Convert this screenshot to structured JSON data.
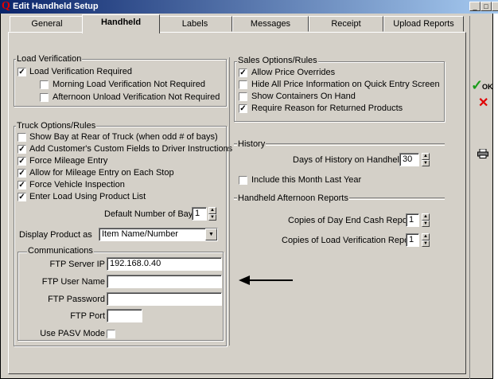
{
  "window": {
    "title": "Edit Handheld Setup"
  },
  "tabs": [
    "General",
    "Handheld",
    "Labels",
    "Messages",
    "Receipt",
    "Upload Reports"
  ],
  "load_verification": {
    "label": "Load Verification",
    "items": [
      {
        "label": "Load Verification Required",
        "checked": true
      },
      {
        "label": "Morning Load Verification Not Required",
        "checked": false
      },
      {
        "label": "Afternoon Unload Verification Not Required",
        "checked": false
      }
    ]
  },
  "truck_options": {
    "label": "Truck Options/Rules",
    "items": [
      {
        "label": "Show Bay at Rear of Truck (when odd # of bays)",
        "checked": false
      },
      {
        "label": "Add Customer's Custom Fields to Driver Instructions",
        "checked": true
      },
      {
        "label": "Force Mileage Entry",
        "checked": true
      },
      {
        "label": "Allow for Mileage Entry on Each Stop",
        "checked": true
      },
      {
        "label": "Force Vehicle Inspection",
        "checked": true
      },
      {
        "label": "Enter Load Using Product List",
        "checked": true
      }
    ],
    "bays_label": "Default Number of Bays",
    "bays_value": "1",
    "display_product_label": "Display Product as",
    "display_product_value": "Item Name/Number"
  },
  "communications": {
    "label": "Communications",
    "ftp_server_label": "FTP Server IP",
    "ftp_server_value": "192.168.0.40",
    "ftp_user_label": "FTP User Name",
    "ftp_user_value": "",
    "ftp_password_label": "FTP Password",
    "ftp_password_value": "",
    "ftp_port_label": "FTP Port",
    "ftp_port_value": "",
    "pasv_label": "Use PASV Mode",
    "pasv_checked": false
  },
  "sales_options": {
    "label": "Sales Options/Rules",
    "items": [
      {
        "label": "Allow Price Overrides",
        "checked": true
      },
      {
        "label": "Hide All Price Information on Quick Entry Screen",
        "checked": false
      },
      {
        "label": "Show Containers On Hand",
        "checked": false
      },
      {
        "label": "Require Reason for Returned Products",
        "checked": true
      }
    ]
  },
  "history": {
    "label": "History",
    "days_label": "Days of History on Handheld",
    "days_value": "30",
    "include_label": "Include this Month Last Year",
    "include_checked": false
  },
  "afternoon_reports": {
    "label": "Handheld Afternoon Reports",
    "day_end_label": "Copies of Day End Cash Report",
    "day_end_value": "1",
    "load_ver_label": "Copies of Load Verification Report",
    "load_ver_value": "1"
  },
  "side_buttons": {
    "ok_label": "OK"
  }
}
